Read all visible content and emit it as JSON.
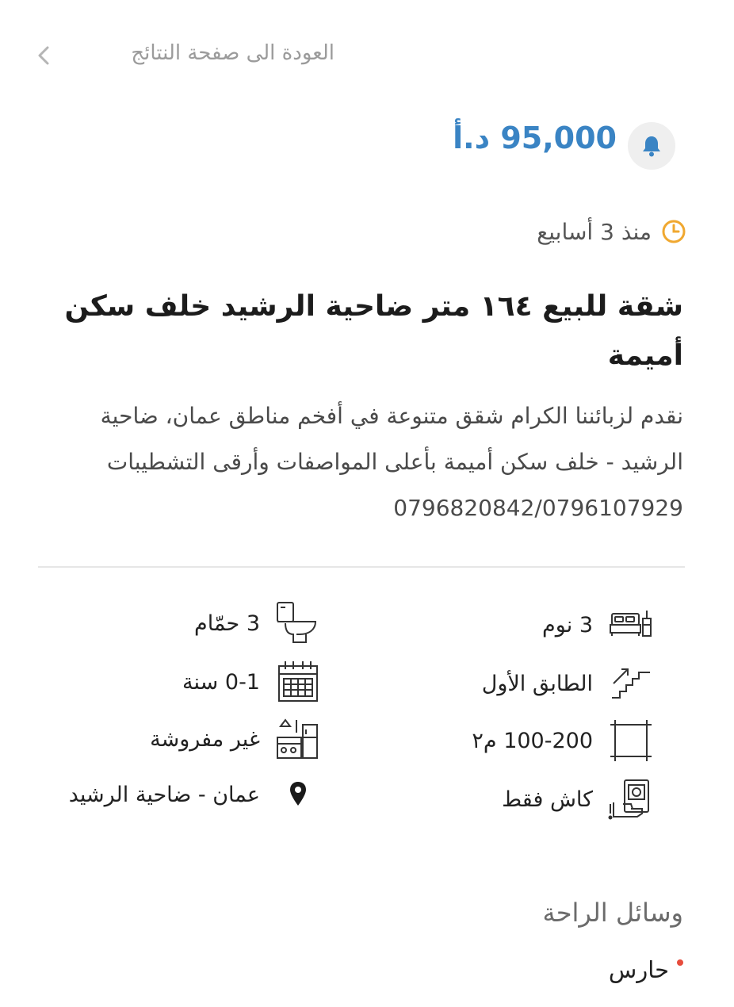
{
  "nav": {
    "back_label": "العودة الى صفحة النتائج"
  },
  "listing": {
    "price": "95,000 د.أ",
    "posted": "منذ 3 أسابيع",
    "title": "شقة للبيع ١٦٤ متر ضاحية الرشيد خلف سكن أميمة",
    "description": "نقدم لزبائننا الكرام شقق متنوعة في أفخم مناطق عمان، ضاحية الرشيد - خلف سكن أميمة بأعلى المواصفات وأرقى التشطيبات 0796820842/0796107929"
  },
  "features": {
    "bedrooms": "3 نوم",
    "bathrooms": "3 حمّام",
    "floor": "الطابق الأول",
    "age": "0-1 سنة",
    "area": "100-200 م٢",
    "furnishing": "غير مفروشة",
    "payment": "كاش فقط",
    "location": "عمان - ضاحية الرشيد"
  },
  "amenities": {
    "heading": "وسائل الراحة",
    "items": [
      "حارس"
    ]
  },
  "colors": {
    "price": "#3a84c4",
    "clock": "#f0a830",
    "bullet": "#e74c3c"
  },
  "icons": {
    "back": "chevron-left-icon",
    "bell": "bell-icon",
    "clock": "clock-icon",
    "bed": "bed-icon",
    "toilet": "toilet-icon",
    "stairs": "stairs-icon",
    "calendar": "calendar-icon",
    "area": "area-icon",
    "kitchen": "kitchen-icon",
    "cash": "cash-icon",
    "pin": "location-pin-icon"
  }
}
